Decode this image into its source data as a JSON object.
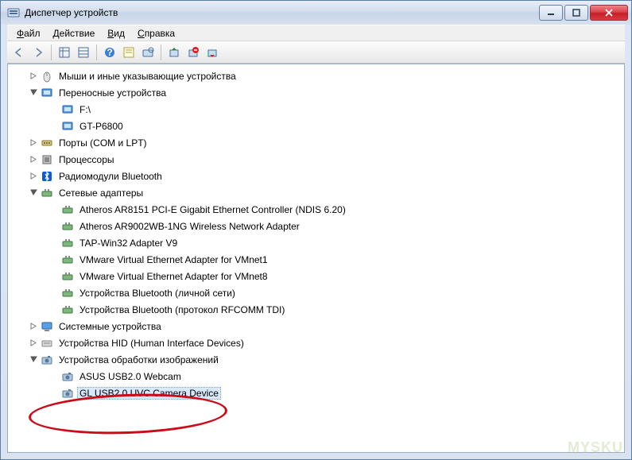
{
  "window": {
    "title": "Диспетчер устройств"
  },
  "menu": {
    "file": "Файл",
    "action": "Действие",
    "view": "Вид",
    "help": "Справка"
  },
  "tree": {
    "mice": "Мыши и иные указывающие устройства",
    "portable": "Переносные устройства",
    "portable_items": {
      "f": "F:\\",
      "gtp": "GT-P6800"
    },
    "ports": "Порты (COM и LPT)",
    "cpu": "Процессоры",
    "bt": "Радиомодули Bluetooth",
    "net": "Сетевые адаптеры",
    "net_items": {
      "ath1": "Atheros AR8151 PCI-E Gigabit Ethernet Controller (NDIS 6.20)",
      "ath2": "Atheros AR9002WB-1NG Wireless Network Adapter",
      "tap": "TAP-Win32 Adapter V9",
      "vm1": "VMware Virtual Ethernet Adapter for VMnet1",
      "vm8": "VMware Virtual Ethernet Adapter for VMnet8",
      "btpan": "Устройства Bluetooth (личной сети)",
      "btrf": "Устройства Bluetooth (протокол RFCOMM TDI)"
    },
    "sys": "Системные устройства",
    "hid": "Устройства HID (Human Interface Devices)",
    "imaging": "Устройства обработки изображений",
    "imaging_items": {
      "asus": "ASUS USB2.0 Webcam",
      "gl": "GL USB2.0 UVC Camera Device"
    }
  },
  "watermark": "MYSKU"
}
